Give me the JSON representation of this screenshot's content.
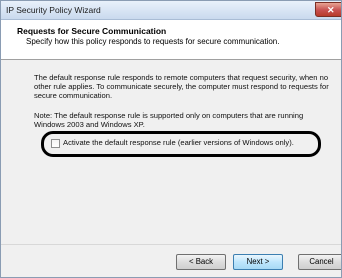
{
  "window": {
    "title": "IP Security Policy Wizard",
    "close_glyph": "✕",
    "close_icon": "close-icon"
  },
  "header": {
    "title": "Requests for Secure Communication",
    "subtitle": "Specify how this policy responds to requests for secure communication."
  },
  "body": {
    "paragraph1": "The default response rule responds to remote computers that request security, when no other rule applies. To communicate securely, the computer must respond to requests for secure communication.",
    "paragraph2": "Note: The default response rule is supported only on computers that are running Windows 2003 and Windows XP."
  },
  "option": {
    "checkbox_label": "Activate the default response rule (earlier versions of Windows only).",
    "checked": false
  },
  "buttons": {
    "back": "< Back",
    "next": "Next >",
    "cancel": "Cancel"
  },
  "colors": {
    "title_bar": "#c9d9ee",
    "close_button": "#c75050",
    "highlight_ring": "#000000",
    "default_button": "#bee6fd"
  }
}
